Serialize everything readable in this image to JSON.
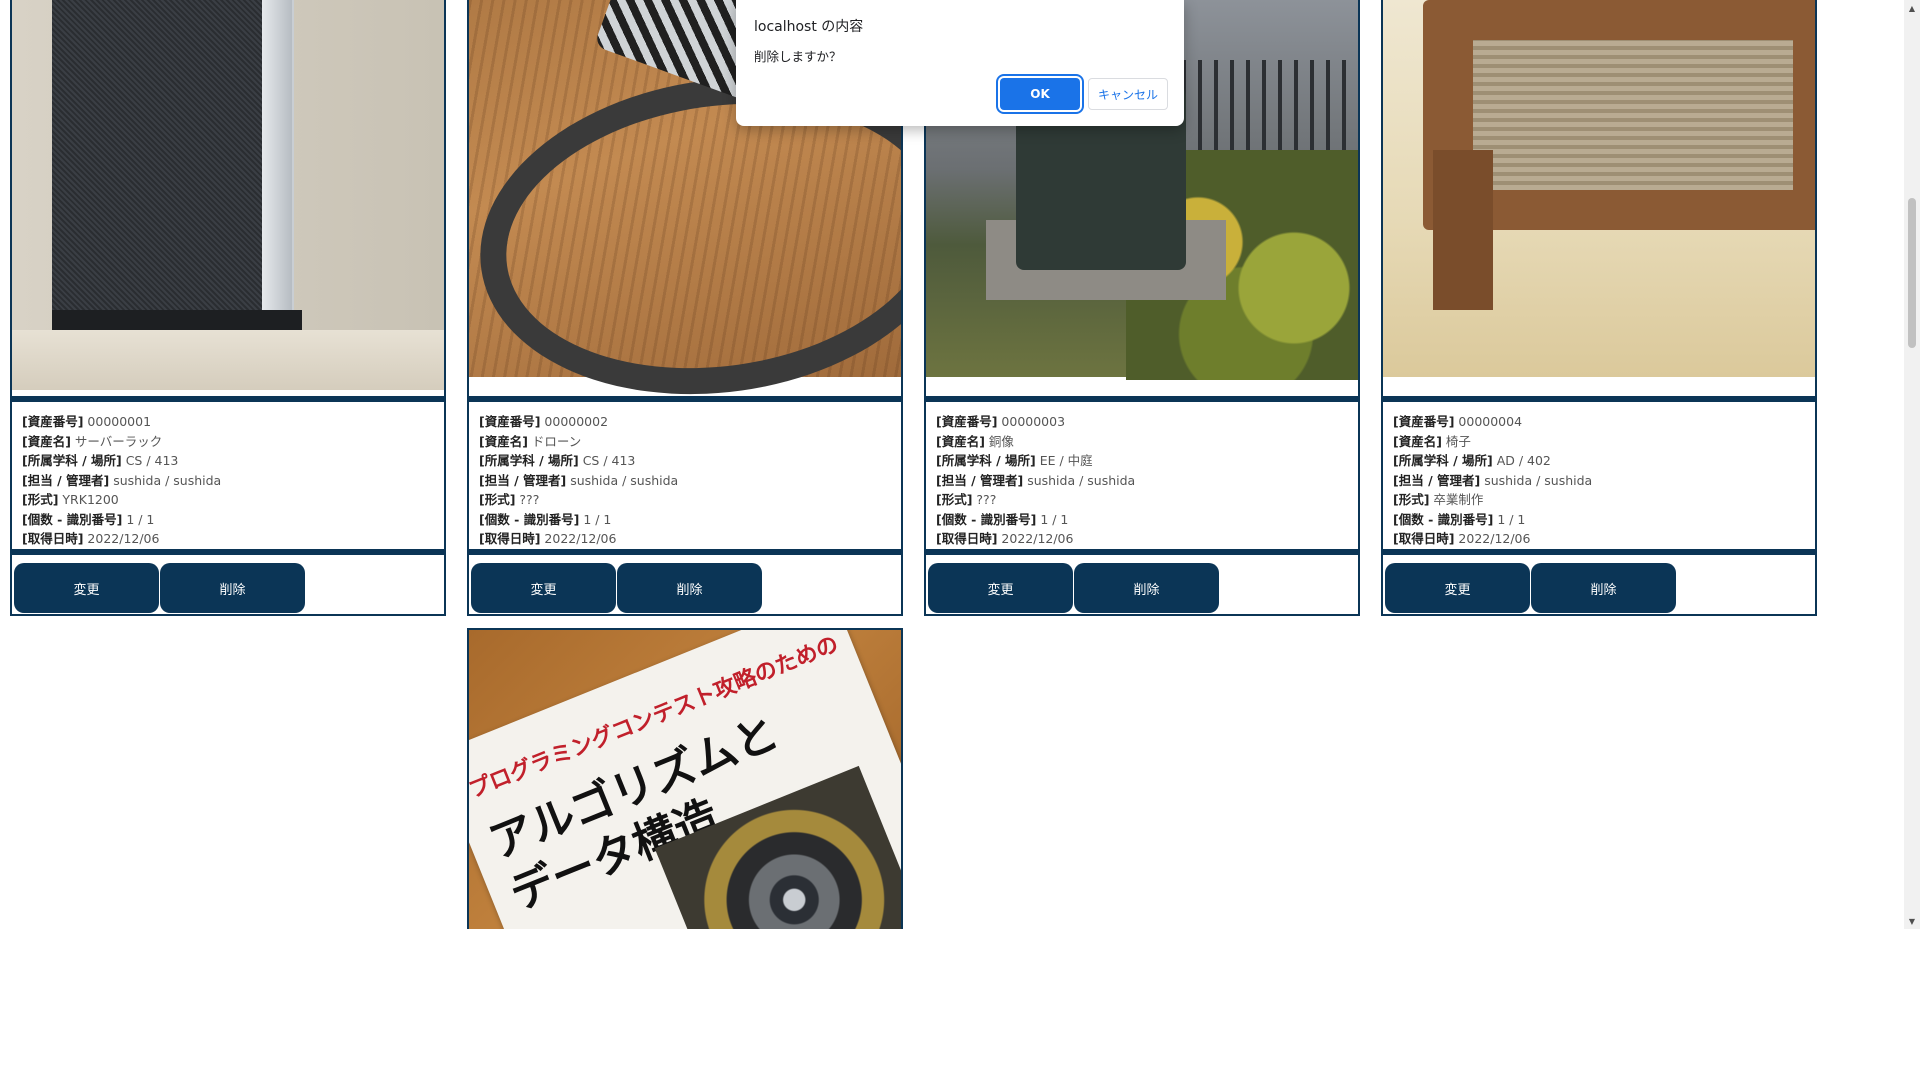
{
  "dialog": {
    "title": "localhost の内容",
    "message": "削除しますか？",
    "ok_label": "OK",
    "cancel_label": "キャンセル"
  },
  "labels": {
    "asset_number": "[資産番号]",
    "asset_name": "[資産名]",
    "dept_location": "[所属学科 / 場所]",
    "owner_manager": "[担当 / 管理者]",
    "model": "[形式]",
    "count_id": "[個数 - 識別番号]",
    "acquired": "[取得日時]"
  },
  "buttons": {
    "edit": "変更",
    "delete": "削除"
  },
  "assets": [
    {
      "asset_number": "00000001",
      "asset_name": "サーバーラック",
      "dept_location": "CS / 413",
      "owner_manager": "sushida / sushida",
      "model": "YRK1200",
      "count_id": "1 / 1",
      "acquired": "2022/12/06",
      "photo": "server-rack"
    },
    {
      "asset_number": "00000002",
      "asset_name": "ドローン",
      "dept_location": "CS / 413",
      "owner_manager": "sushida / sushida",
      "model": "???",
      "count_id": "1 / 1",
      "acquired": "2022/12/06",
      "photo": "drone"
    },
    {
      "asset_number": "00000003",
      "asset_name": "銅像",
      "dept_location": "EE / 中庭",
      "owner_manager": "sushida / sushida",
      "model": "???",
      "count_id": "1 / 1",
      "acquired": "2022/12/06",
      "photo": "statue"
    },
    {
      "asset_number": "00000004",
      "asset_name": "椅子",
      "dept_location": "AD / 402",
      "owner_manager": "sushida / sushida",
      "model": "卒業制作",
      "count_id": "1 / 1",
      "acquired": "2022/12/06",
      "photo": "chair"
    },
    {
      "photo": "book",
      "book_text": {
        "top": "プログラミングコンテスト攻略のための",
        "line1": "アルゴリズムと",
        "line2": "データ構造"
      }
    }
  ]
}
